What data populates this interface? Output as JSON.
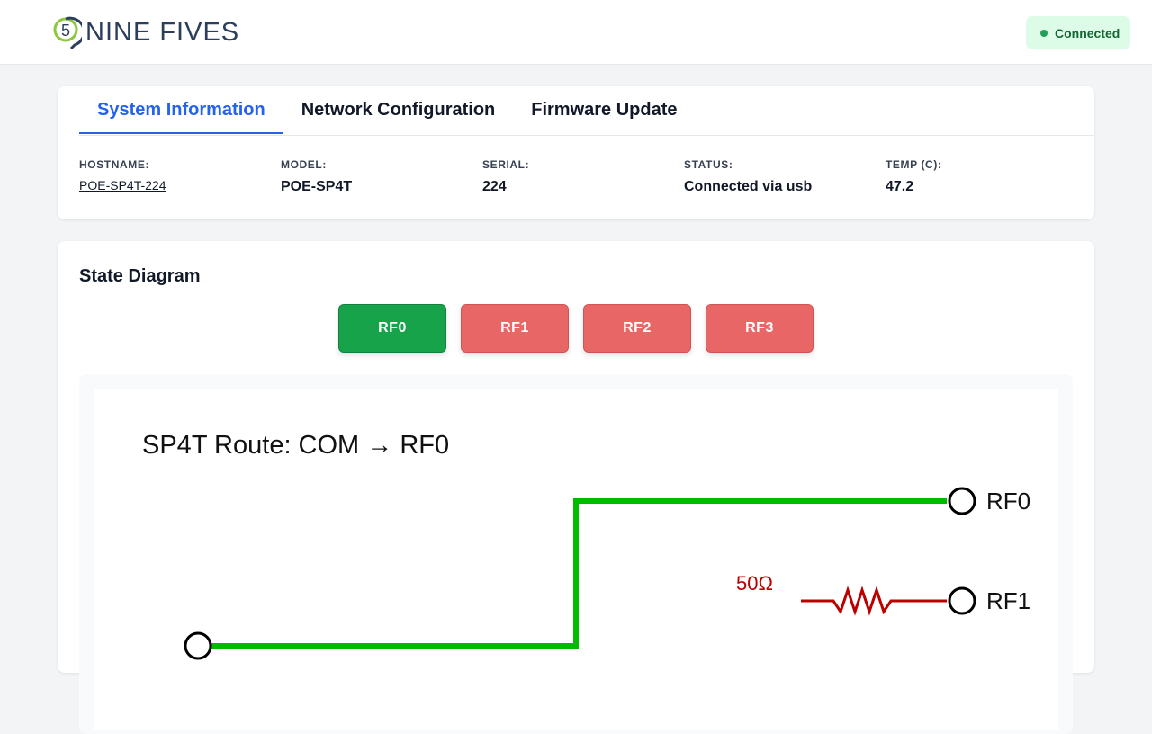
{
  "header": {
    "brand": "NINE FIVES",
    "logo_digit": "5",
    "connection_status": "Connected"
  },
  "tabs": [
    {
      "label": "System Information",
      "active": true
    },
    {
      "label": "Network Configuration",
      "active": false
    },
    {
      "label": "Firmware Update",
      "active": false
    }
  ],
  "system_info": {
    "hostname_label": "HOSTNAME:",
    "hostname": "POE-SP4T-224",
    "model_label": "MODEL:",
    "model": "POE-SP4T",
    "serial_label": "SERIAL:",
    "serial": "224",
    "status_label": "STATUS:",
    "status": "Connected via usb",
    "temp_label": "TEMP (C):",
    "temp": "47.2"
  },
  "state_diagram": {
    "title": "State Diagram",
    "buttons": [
      {
        "label": "RF0",
        "active": true
      },
      {
        "label": "RF1",
        "active": false
      },
      {
        "label": "RF2",
        "active": false
      },
      {
        "label": "RF3",
        "active": false
      }
    ],
    "route_title": "SP4T Route: COM → RF0",
    "port_rf0": "RF0",
    "port_rf1": "RF1",
    "termination_label": "50Ω"
  },
  "colors": {
    "active_path": "#00bb00",
    "termination": "#bb0000",
    "tab_active": "#2563eb",
    "button_active": "#16a34a",
    "button_inactive": "#e86666",
    "badge_bg": "#dcfce7"
  }
}
